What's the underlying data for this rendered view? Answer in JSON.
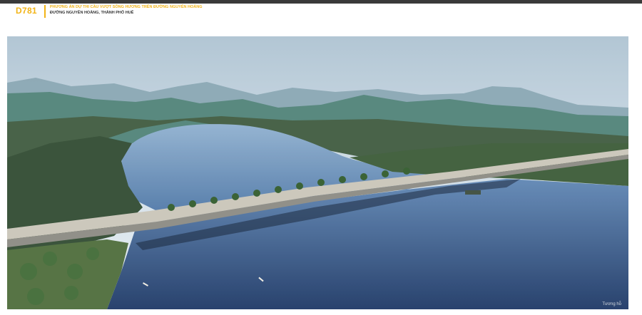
{
  "header": {
    "code": "D781",
    "title": "PHƯƠNG ÁN DỰ THI CẦU VƯỢT SÔNG HƯƠNG TRÊN ĐƯỜNG NGUYỄN HOÀNG",
    "subtitle": "ĐƯỜNG NGUYỄN HOÀNG, THÀNH PHỐ HUẾ"
  },
  "colors": {
    "accent": "#f2b417",
    "topbar": "#3a3a3a",
    "river": "#1f3f6e",
    "sky": "#c8d8e4"
  },
  "image": {
    "watermark": "Tương hỗ"
  }
}
